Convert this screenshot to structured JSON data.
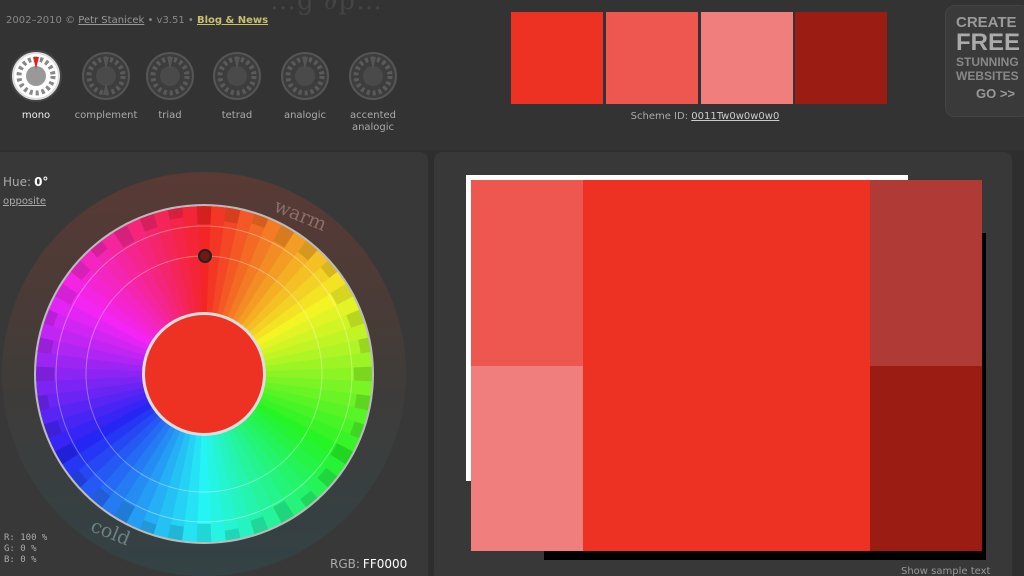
{
  "header": {
    "logo_partial": "…g  ∂p…",
    "years": "2002–2010 ©",
    "author": "Petr Stanicek",
    "version": "• v3.51 •",
    "blog": "Blog & News"
  },
  "scheme_types": [
    {
      "label": "mono",
      "active": true
    },
    {
      "label": "complement",
      "active": false
    },
    {
      "label": "triad",
      "active": false
    },
    {
      "label": "tetrad",
      "active": false
    },
    {
      "label": "analogic",
      "active": false
    },
    {
      "label": "accented analogic",
      "active": false
    }
  ],
  "swatches": [
    "#ED3224",
    "#EE5650",
    "#F07E7C",
    "#9A1C12"
  ],
  "scheme_id": {
    "label": "Scheme ID:",
    "value": "0011Tw0w0w0w0"
  },
  "ad": {
    "line1": "CREATE",
    "line2": "FREE",
    "line3": "STUNNING",
    "line4": "WEBSITES",
    "go": "GO >>"
  },
  "wheel": {
    "hue_label": "Hue:",
    "hue_value": "0°",
    "opposite": "opposite",
    "warm": "warm",
    "cold": "cold",
    "center_color": "#ED3224"
  },
  "rgb": {
    "r": "R:  100 %",
    "g": "G:    0 %",
    "b": "B:    0 %",
    "label": "RGB:",
    "value": "FF0000"
  },
  "preview": {
    "colors": {
      "main": "#ED3224",
      "light": "#EE5650",
      "pale": "#F07E7C",
      "dark1": "#B03A35",
      "dark2": "#9A1C12"
    },
    "sample_text": "Show sample text"
  }
}
